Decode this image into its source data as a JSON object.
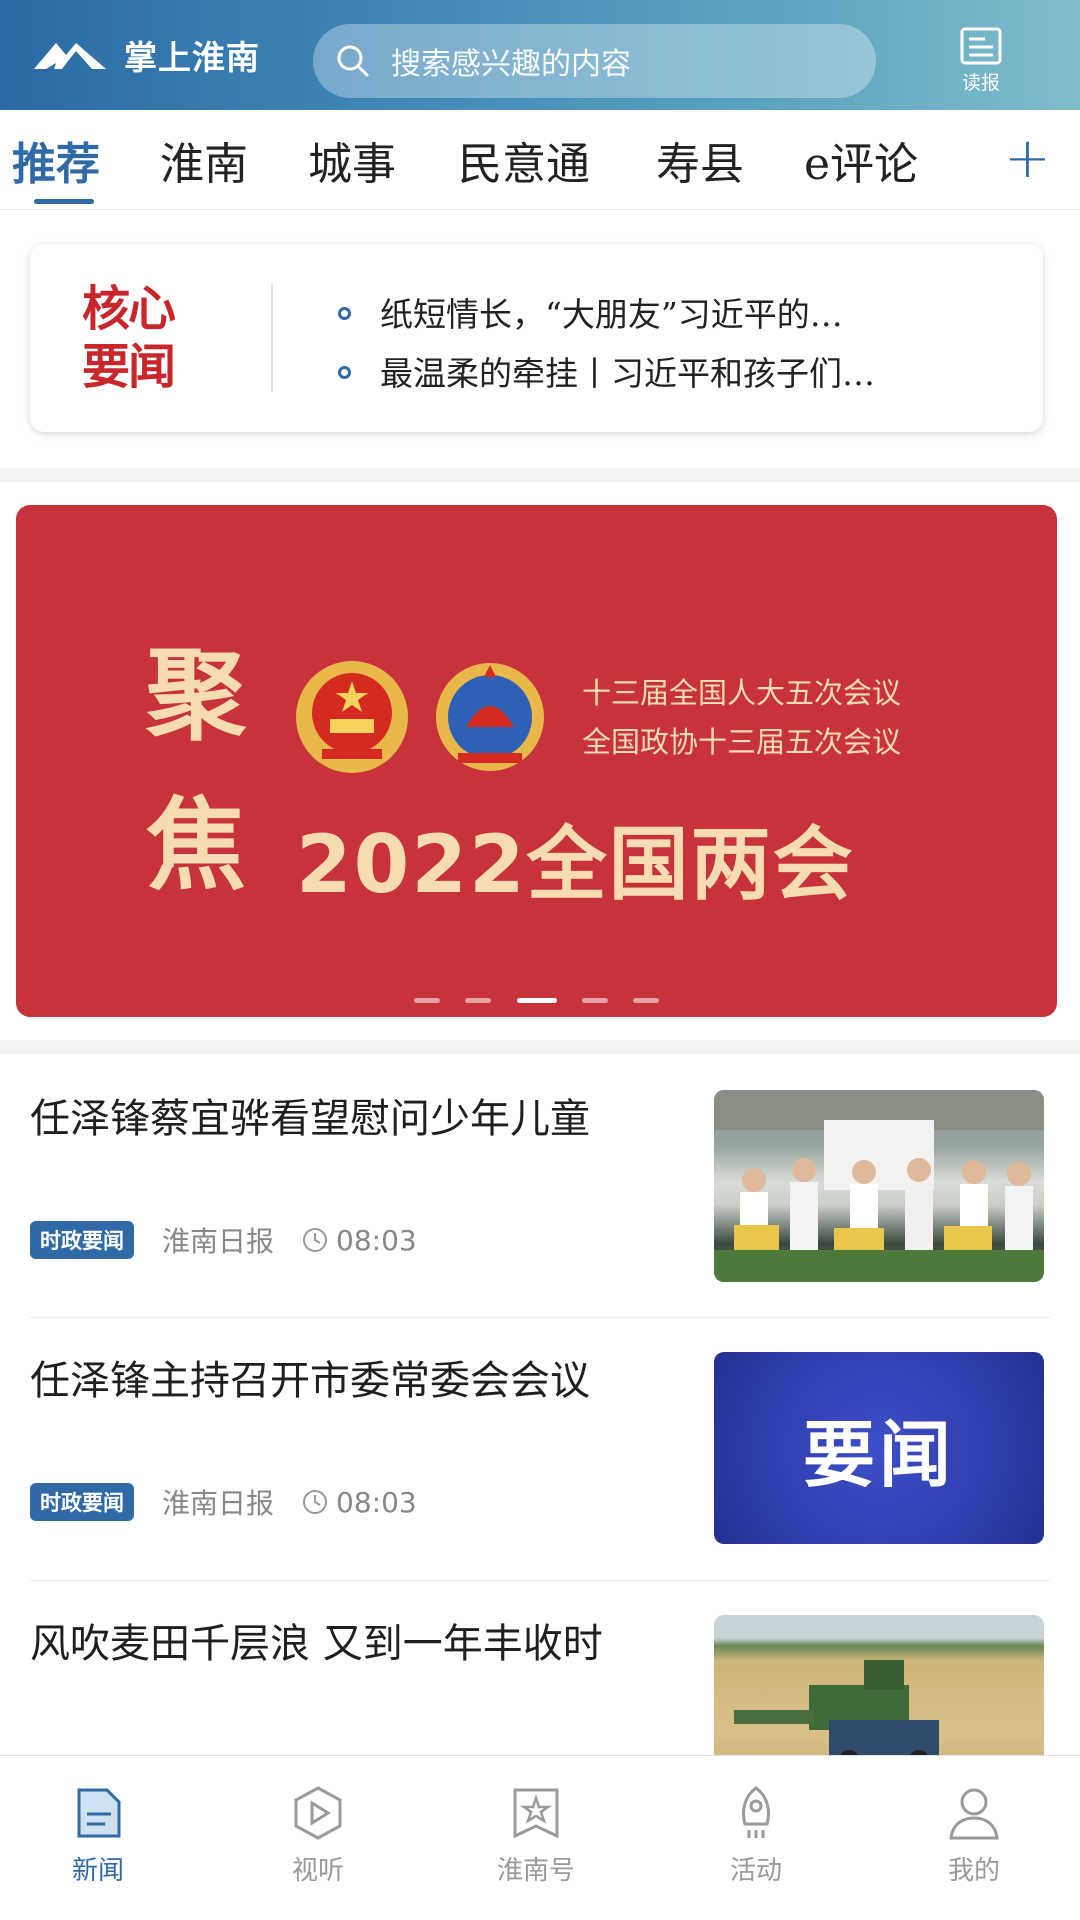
{
  "header": {
    "app_name": "掌上淮南",
    "search_placeholder": "搜索感兴趣的内容",
    "read_paper_label": "读报",
    "brand_color": "#2f6aa6"
  },
  "tabs": [
    {
      "label": "推荐",
      "active": true
    },
    {
      "label": "淮南",
      "active": false
    },
    {
      "label": "城事",
      "active": false
    },
    {
      "label": "民意通",
      "active": false
    },
    {
      "label": "寿县",
      "active": false
    },
    {
      "label": "e评论",
      "active": false
    }
  ],
  "tab_add_label": "+",
  "core_news": {
    "title": "核心要闻",
    "items": [
      "纸短情长，“大朋友”习近平的…",
      "最温柔的牵挂丨习近平和孩子们…"
    ]
  },
  "banner": {
    "char_top": "聚",
    "char_bottom": "焦",
    "line1": "十三届全国人大五次会议",
    "line2": "全国政协十三届五次会议",
    "main": "2022全国两会",
    "slide_count": 5,
    "active_slide": 3
  },
  "articles": [
    {
      "title": "任泽锋蔡宜骅看望慰问少年儿童",
      "badge": "时政要闻",
      "source": "淮南日报",
      "time": "08:03",
      "thumb": "photo-children"
    },
    {
      "title": "任泽锋主持召开市委常委会会议",
      "badge": "时政要闻",
      "source": "淮南日报",
      "time": "08:03",
      "thumb": "yaowen",
      "thumb_text": "要闻"
    },
    {
      "title": "风吹麦田千层浪  又到一年丰收时",
      "thumb": "photo-harvest"
    }
  ],
  "bottom_nav": [
    {
      "label": "新闻",
      "icon": "news-icon",
      "active": true
    },
    {
      "label": "视听",
      "icon": "play-icon",
      "active": false
    },
    {
      "label": "淮南号",
      "icon": "star-bookmark-icon",
      "active": false
    },
    {
      "label": "活动",
      "icon": "rocket-icon",
      "active": false
    },
    {
      "label": "我的",
      "icon": "user-icon",
      "active": false
    }
  ]
}
